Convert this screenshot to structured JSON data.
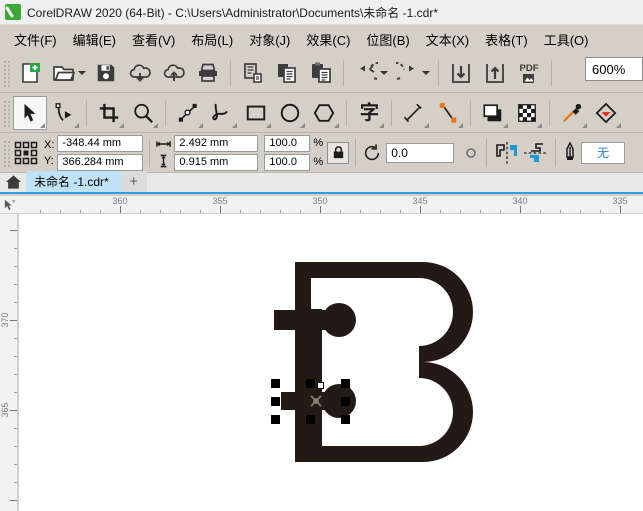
{
  "window": {
    "title": "CorelDRAW 2020 (64-Bit) - C:\\Users\\Administrator\\Documents\\未命名 -1.cdr*",
    "logo_icon": "coreldraw-balloon-icon"
  },
  "menubar": {
    "items": [
      {
        "label": "文件(F)",
        "name": "menu-file"
      },
      {
        "label": "编辑(E)",
        "name": "menu-edit"
      },
      {
        "label": "查看(V)",
        "name": "menu-view"
      },
      {
        "label": "布局(L)",
        "name": "menu-layout"
      },
      {
        "label": "对象(J)",
        "name": "menu-object"
      },
      {
        "label": "效果(C)",
        "name": "menu-effects"
      },
      {
        "label": "位图(B)",
        "name": "menu-bitmaps"
      },
      {
        "label": "文本(X)",
        "name": "menu-text"
      },
      {
        "label": "表格(T)",
        "name": "menu-table"
      },
      {
        "label": "工具(O)",
        "name": "menu-tools"
      }
    ]
  },
  "toolbar": {
    "buttons": [
      {
        "icon": "new-document-icon",
        "name": "new-document-button"
      },
      {
        "icon": "open-folder-icon",
        "name": "open-document-button"
      },
      {
        "icon": "save-icon",
        "name": "save-document-button"
      },
      {
        "icon": "cloud-download-icon",
        "name": "cloud-download-button"
      },
      {
        "icon": "cloud-upload-icon",
        "name": "cloud-upload-button"
      },
      {
        "icon": "print-icon",
        "name": "print-button"
      },
      {
        "icon": "cut-icon",
        "name": "cut-button"
      },
      {
        "icon": "copy-icon",
        "name": "copy-button"
      },
      {
        "icon": "paste-icon",
        "name": "paste-button"
      },
      {
        "icon": "undo-icon",
        "name": "undo-button"
      },
      {
        "icon": "redo-icon",
        "name": "redo-button"
      },
      {
        "icon": "import-icon",
        "name": "import-button"
      },
      {
        "icon": "export-icon",
        "name": "export-button"
      },
      {
        "icon": "export-pdf-icon",
        "name": "export-pdf-button"
      }
    ],
    "zoom_level": "600%"
  },
  "toolpalette": {
    "tools": [
      {
        "icon": "pick-tool-icon",
        "name": "tool-pick",
        "active": true
      },
      {
        "icon": "shape-tool-icon",
        "name": "tool-shape",
        "active": false
      },
      {
        "icon": "crop-tool-icon",
        "name": "tool-crop",
        "active": false
      },
      {
        "icon": "zoom-tool-icon",
        "name": "tool-zoom",
        "active": false
      },
      {
        "icon": "freehand-tool-icon",
        "name": "tool-freehand",
        "active": false
      },
      {
        "icon": "bspline-tool-icon",
        "name": "tool-bspline",
        "active": false
      },
      {
        "icon": "rectangle-tool-icon",
        "name": "tool-rectangle",
        "active": false
      },
      {
        "icon": "ellipse-tool-icon",
        "name": "tool-ellipse",
        "active": false
      },
      {
        "icon": "polygon-tool-icon",
        "name": "tool-polygon",
        "active": false
      },
      {
        "icon": "text-tool-icon",
        "name": "tool-text",
        "active": false
      },
      {
        "icon": "dimension-tool-icon",
        "name": "tool-dimension",
        "active": false
      },
      {
        "icon": "connector-tool-icon",
        "name": "tool-connector",
        "active": false
      },
      {
        "icon": "drop-shadow-tool-icon",
        "name": "tool-drop-shadow",
        "active": false
      },
      {
        "icon": "transparency-tool-icon",
        "name": "tool-transparency",
        "active": false
      },
      {
        "icon": "eyedropper-tool-icon",
        "name": "tool-eyedropper",
        "active": false
      },
      {
        "icon": "interactive-fill-tool-icon",
        "name": "tool-interactive-fill",
        "active": false
      }
    ]
  },
  "propertybar": {
    "position_label_x": "X:",
    "position_label_y": "Y:",
    "position_x": "-348.44 mm",
    "position_y": "366.284 mm",
    "size_width": "2.492 mm",
    "size_height": "0.915 mm",
    "scale_width": "100.0",
    "scale_height": "100.0",
    "percent_symbol_w": "%",
    "percent_symbol_h": "%",
    "lock_ratio_icon": "lock-ratio-icon",
    "rotation_angle": "0.0",
    "mirror_horizontal_icon": "mirror-horizontal-icon",
    "mirror_vertical_icon": "mirror-vertical-icon",
    "outline_width_icon": "outline-pen-icon",
    "outline_width_value": "无"
  },
  "tabstrip": {
    "home_icon": "home-icon",
    "document_tab": "未命名 -1.cdr*",
    "new_tab_label": "+"
  },
  "rulers": {
    "horizontal_unit_icon": "ruler-origin-icon",
    "horizontal_labels": [
      "360",
      "355",
      "350",
      "345",
      "340",
      "335"
    ],
    "vertical_labels": [
      "370",
      "365"
    ]
  },
  "canvas": {
    "artwork_color": "#231a16",
    "artwork_name": "c-clamp-drawing",
    "selection": {
      "handle_count": 8,
      "rotation_dot": "top-center-node"
    }
  }
}
